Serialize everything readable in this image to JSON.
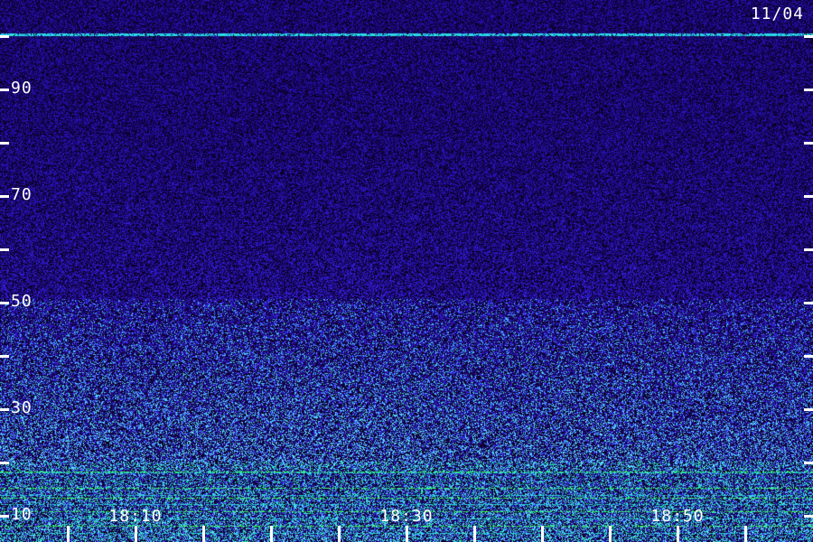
{
  "date": "11/04",
  "y_axis": {
    "labels": [
      "90",
      "70",
      "50",
      "30",
      "10"
    ],
    "range": [
      10,
      100
    ]
  },
  "x_axis": {
    "labels": [
      "18:10",
      "18:30",
      "18:50"
    ],
    "range_minutes": [
      18.0,
      18.98
    ]
  },
  "colors": {
    "background": "#0a0028",
    "noise_low": "#1a0a7a",
    "noise_high": "#3a30ff",
    "cyan": "#28d8e8",
    "green": "#3cff6a"
  }
}
